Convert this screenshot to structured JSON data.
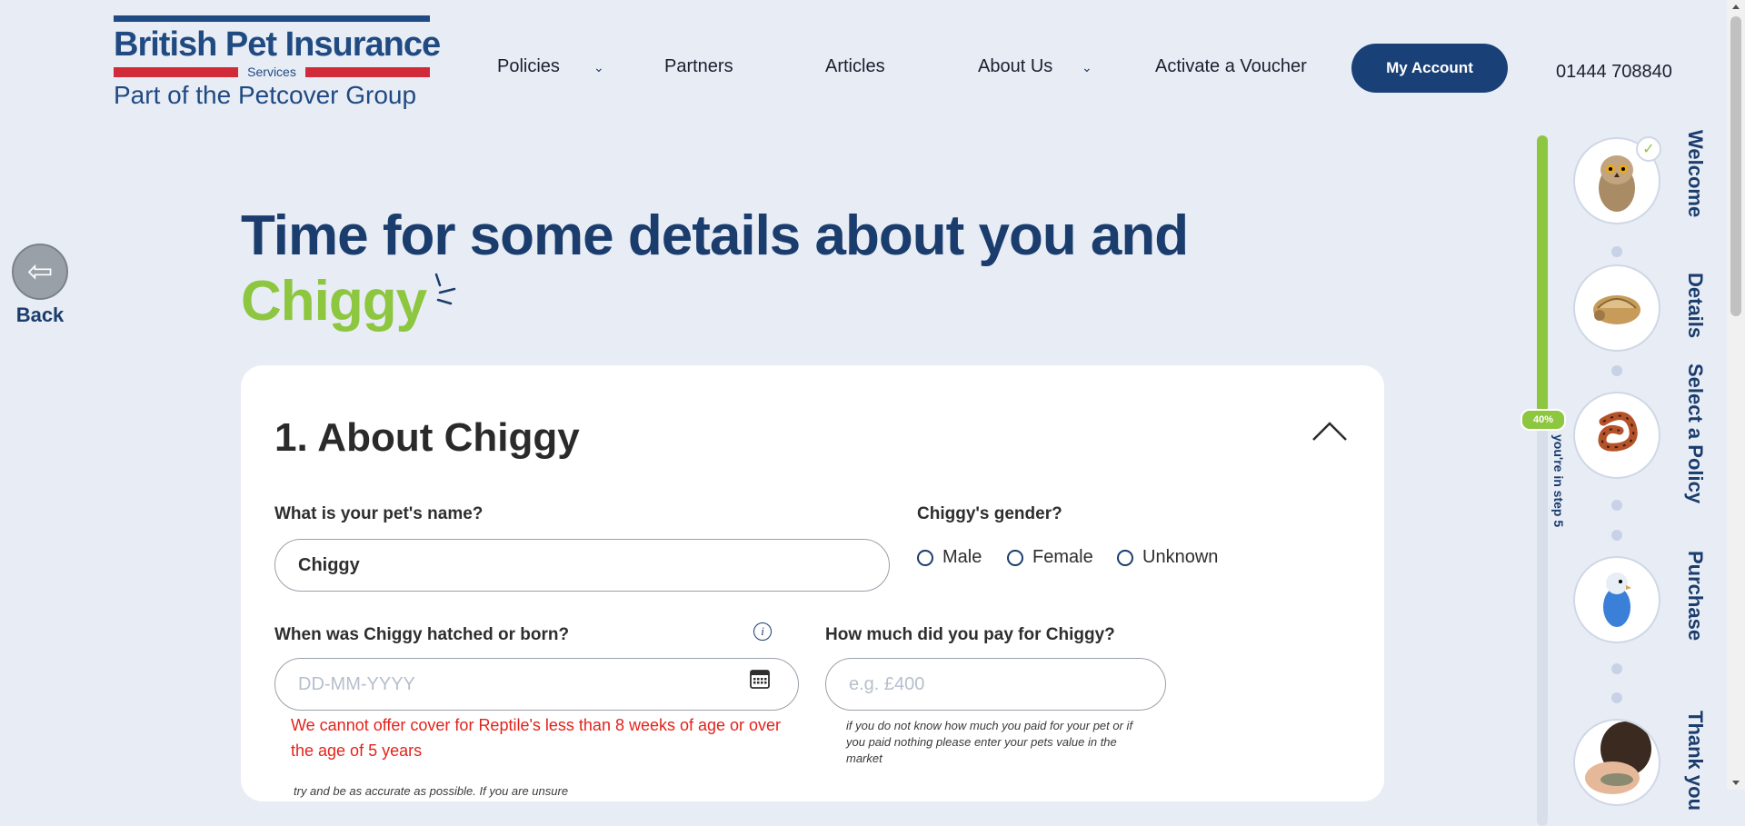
{
  "header": {
    "logo": {
      "brand": "British Pet Insurance",
      "services": "Services",
      "group": "Part of the Petcover Group"
    },
    "nav": [
      {
        "label": "Policies",
        "has_dropdown": true
      },
      {
        "label": "Partners",
        "has_dropdown": false
      },
      {
        "label": "Articles",
        "has_dropdown": false
      },
      {
        "label": "About Us",
        "has_dropdown": true
      },
      {
        "label": "Activate a Voucher",
        "has_dropdown": false
      }
    ],
    "account_button": "My Account",
    "phone": "01444 708840"
  },
  "back": {
    "label": "Back"
  },
  "title": {
    "line1": "Time for some details about you and",
    "pet_name": "Chiggy"
  },
  "section": {
    "title": "1. About Chiggy",
    "name_label": "What is your pet's name?",
    "name_value": "Chiggy",
    "gender_label": "Chiggy's gender?",
    "gender_options": [
      "Male",
      "Female",
      "Unknown"
    ],
    "dob_label": "When was Chiggy hatched or born?",
    "dob_placeholder": "DD-MM-YYYY",
    "price_label": "How much did you pay for Chiggy?",
    "price_placeholder": "e.g. £400",
    "dob_error": "We cannot offer cover for Reptile's less than 8 weeks of age or over the age of 5 years",
    "price_hint": "if you do not know how much you paid for your pet or if you paid nothing please enter your pets value in the market",
    "dob_hint": "try and be as accurate as possible. If you are unsure"
  },
  "progress": {
    "percent_label": "40%",
    "percent": 0.4,
    "step_text": "you're in step 5",
    "steps": [
      {
        "label": "Welcome",
        "image": "owl",
        "completed": true
      },
      {
        "label": "Details",
        "image": "tortoise",
        "completed": false
      },
      {
        "label": "Select a Policy",
        "image": "snake",
        "completed": false
      },
      {
        "label": "Purchase",
        "image": "budgie",
        "completed": false
      },
      {
        "label": "Thank you",
        "image": "lizard-on-hand",
        "completed": false
      }
    ]
  },
  "colors": {
    "navy": "#1a3d6d",
    "green": "#8dc63f",
    "red": "#e2231a",
    "brand_red": "#d12b3a",
    "bg": "#e8ecf5"
  }
}
